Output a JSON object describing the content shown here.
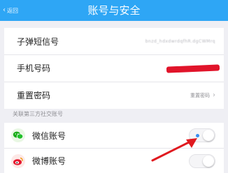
{
  "navbar": {
    "back_label": "返回",
    "title": "账号与安全",
    "bg_color": "#2ea6f5"
  },
  "account": {
    "rows": [
      {
        "label": "子弹短信号",
        "value": "bnzd_hdxdwrdqfhR.dgCWMrq"
      },
      {
        "label": "手机号码",
        "value": ""
      },
      {
        "label": "重置密码",
        "value": "重置密码"
      }
    ]
  },
  "social_section": {
    "header": "关联第三方社交账号",
    "items": [
      {
        "label": "微信账号",
        "icon": "wechat-icon",
        "enabled": true
      },
      {
        "label": "微博账号",
        "icon": "weibo-icon",
        "enabled": false
      }
    ]
  },
  "colors": {
    "accent": "#2ea6f5",
    "redaction": "#e1142a",
    "annotation_arrow": "#e0191f",
    "wechat_green": "#1aad19",
    "weibo_red": "#e6162d"
  }
}
